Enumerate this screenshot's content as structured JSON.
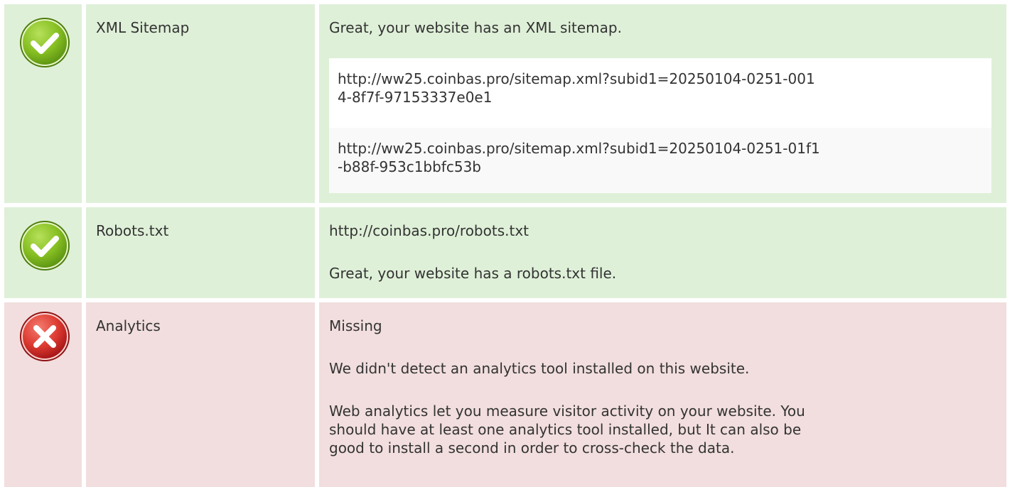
{
  "rows": [
    {
      "status": "pass",
      "icon": "check-icon",
      "label": "XML Sitemap",
      "message": "Great, your website has an XML sitemap.",
      "urls": [
        {
          "line1": "http://ww25.coinbas.pro/sitemap.xml?subid1=20250104-0251-001",
          "line2": "4-8f7f-97153337e0e1"
        },
        {
          "line1": "http://ww25.coinbas.pro/sitemap.xml?subid1=20250104-0251-01f1",
          "line2": "-b88f-953c1bbfc53b"
        }
      ]
    },
    {
      "status": "pass",
      "icon": "check-icon",
      "label": "Robots.txt",
      "url": "http://coinbas.pro/robots.txt",
      "message": "Great, your website has a robots.txt file."
    },
    {
      "status": "fail",
      "icon": "cross-icon",
      "label": "Analytics",
      "status_text": "Missing",
      "message": "We didn't detect an analytics tool installed on this website.",
      "description": [
        "Web analytics let you measure visitor activity on your website. You",
        "should have at least one analytics tool installed, but It can also be",
        "good to install a second in order to cross-check the data."
      ]
    }
  ],
  "colors": {
    "pass_bg": "#dff0d8",
    "fail_bg": "#f2dede",
    "pass_icon": "#7ab51d",
    "fail_icon": "#d9262b"
  }
}
